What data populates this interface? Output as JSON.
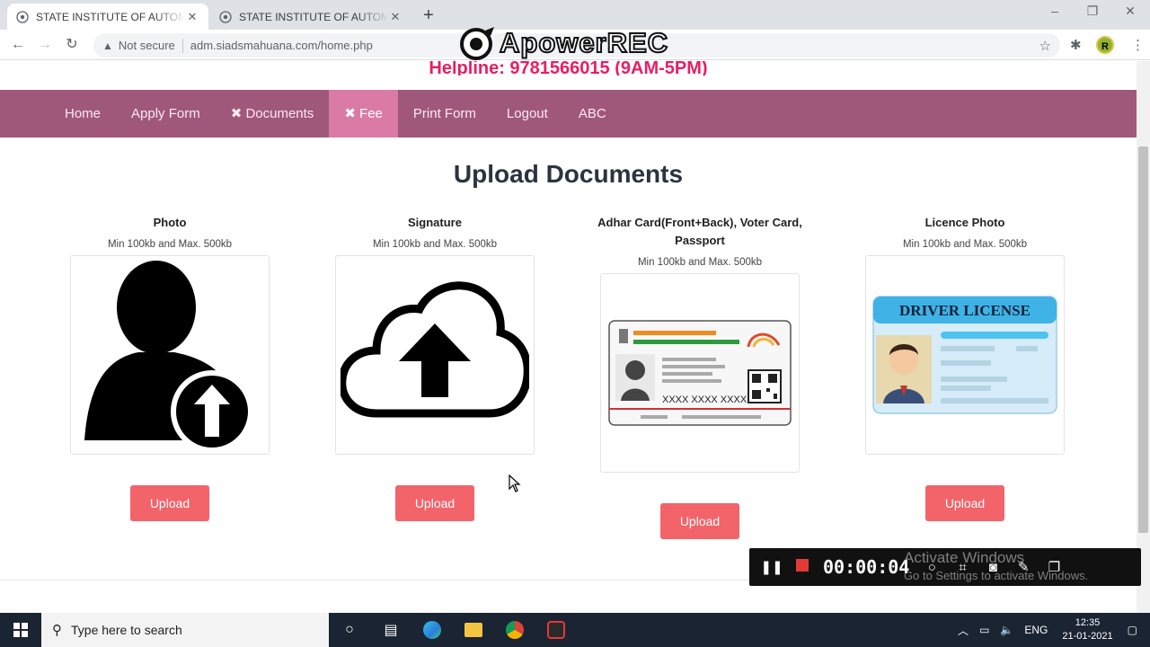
{
  "browser": {
    "tabs": [
      {
        "title": "STATE INSTITUTE OF AUTOMOTIVE",
        "active": true
      },
      {
        "title": "STATE INSTITUTE OF AUTOMOTIVE",
        "active": false
      }
    ],
    "security_label": "Not secure",
    "url": "adm.siadsmahuana.com/home.php",
    "profile_initial": "R"
  },
  "overlay": {
    "recorder_brand": "ApowerREC",
    "timer": "00:00:04",
    "watermark_title": "Activate Windows",
    "watermark_sub": "Go to Settings to activate Windows."
  },
  "site": {
    "helpline": "Helpline: 9781566015 (9AM-5PM)",
    "nav": [
      {
        "label": "Home"
      },
      {
        "label": "Apply Form"
      },
      {
        "label": "✖ Documents"
      },
      {
        "label": "✖ Fee"
      },
      {
        "label": "Print Form"
      },
      {
        "label": "Logout"
      },
      {
        "label": "ABC"
      }
    ],
    "heading": "Upload Documents",
    "documents": [
      {
        "label": "Photo",
        "hint": "Min 100kb and Max. 500kb",
        "button": "Upload",
        "icon": "user-upload-icon"
      },
      {
        "label": "Signature",
        "hint": "Min 100kb and Max. 500kb",
        "button": "Upload",
        "icon": "cloud-upload-icon"
      },
      {
        "label": "Adhar Card(Front+Back), Voter Card, Passport",
        "hint": "Min 100kb and Max. 500kb",
        "button": "Upload",
        "icon": "id-card-icon",
        "card_number": "XXXX XXXX XXXX"
      },
      {
        "label": "Licence Photo",
        "hint": "Min 100kb and Max. 500kb",
        "button": "Upload",
        "icon": "driver-license-icon",
        "license_title": "DRIVER LICENSE"
      }
    ]
  },
  "taskbar": {
    "search_placeholder": "Type here to search",
    "language": "ENG",
    "time": "12:35",
    "date": "21-01-2021"
  },
  "colors": {
    "helpline": "#e91e63",
    "navbar": "#a0587a",
    "navbar_active": "#d97ba5",
    "upload_button": "#f2646a",
    "heading": "#2b3340"
  }
}
